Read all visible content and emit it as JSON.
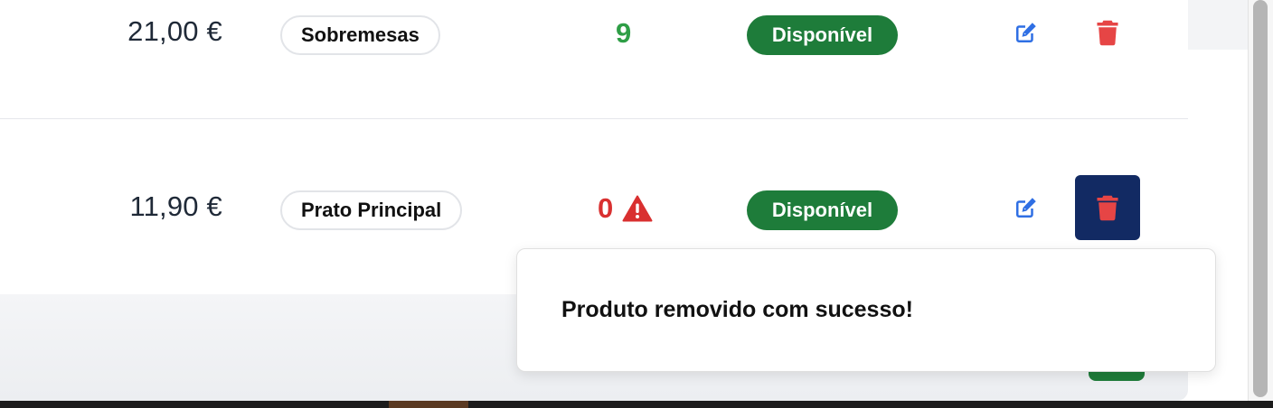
{
  "products": [
    {
      "price": "21,00 €",
      "category": "Sobremesas",
      "stock": "9",
      "stock_warning": false,
      "status": "Disponível"
    },
    {
      "price": "11,90 €",
      "category": "Prato Principal",
      "stock": "0",
      "stock_warning": true,
      "status": "Disponível"
    }
  ],
  "toast": {
    "message": "Produto removido com sucesso!"
  },
  "colors": {
    "status_badge": "#1e7c3a",
    "stock_ok": "#2e9e46",
    "stock_low": "#d93030",
    "edit_icon": "#2f6fe4",
    "delete_icon": "#e64545",
    "delete_active_bg": "#122a63"
  },
  "icons": {
    "edit": "edit-icon",
    "delete": "trash-icon",
    "warning": "warning-icon"
  }
}
